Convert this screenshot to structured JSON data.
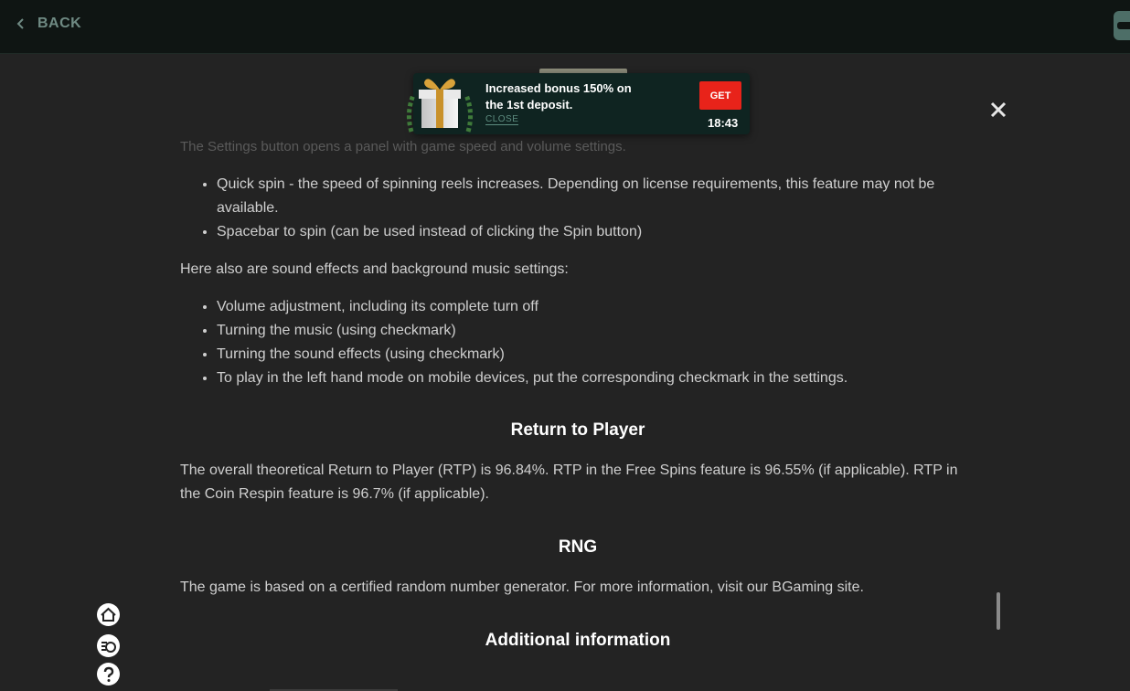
{
  "topbar": {
    "back_label": "BACK"
  },
  "promo": {
    "text_part1": "Increased bonus ",
    "text_bold": "150%",
    "text_part2": " on the 1st deposit.",
    "close_label": "CLOSE",
    "get_label": "GET",
    "timer": "18:43"
  },
  "content": {
    "faded_line": "The Settings button opens a panel with game speed and volume settings.",
    "list1": [
      "Quick spin - the speed of spinning reels increases. Depending on license requirements, this feature may not be available.",
      "Spacebar to spin (can be used instead of clicking the Spin button)"
    ],
    "para1": "Here also are sound effects and background music settings:",
    "list2": [
      "Volume adjustment, including its complete turn off",
      "Turning the music (using checkmark)",
      "Turning the sound effects (using checkmark)",
      "To play in the left hand mode on mobile devices, put the corresponding checkmark in the settings."
    ],
    "rtp_heading": "Return to Player",
    "rtp_text": "The overall theoretical Return to Player (RTP) is 96.84%. RTP in the Free Spins feature is 96.55% (if applicable). RTP in the Coin Respin feature is 96.7% (if applicable).",
    "rng_heading": "RNG",
    "rng_text": "The game is based on a certified random number generator. For more information, visit our BGaming site.",
    "additional_heading": "Additional information"
  },
  "icons": {
    "back": "chevron-left-icon",
    "wallet": "wallet-icon",
    "gift": "gift-icon",
    "close": "close-icon",
    "home": "home-icon",
    "bet": "coins-icon",
    "help": "question-icon"
  },
  "colors": {
    "background": "#232323",
    "topbar": "#0f1513",
    "promo_bg": "#0f2421",
    "get_button": "#e8231a",
    "accent_muted": "#6f8a83"
  }
}
